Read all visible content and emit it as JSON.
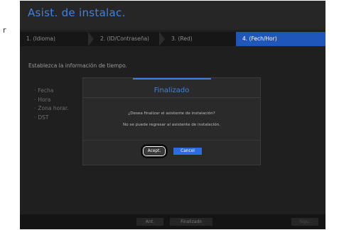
{
  "stray": "r",
  "window": {
    "title": "Asist. de instalac."
  },
  "steps": [
    {
      "label": "1. (Idioma)"
    },
    {
      "label": "2. (ID/Contraseña)"
    },
    {
      "label": "3. (Red)"
    },
    {
      "label": "4. (Fech/Hor)",
      "active": true
    }
  ],
  "main": {
    "instruction": "Establezca la información de tiempo.",
    "fields": [
      "Fecha",
      "Hora",
      "Zona horar.",
      "DST"
    ]
  },
  "dialog": {
    "title": "Finalizado",
    "message_1": "¿Desea finalizar el asistente de instalación?",
    "message_2": "No se puede regresar al asistente de instalación.",
    "accept_label": "Acept.",
    "cancel_label": "Cancel"
  },
  "footer": {
    "prev_label": "Ant.",
    "finish_label": "Finalizado",
    "next_label": "Sigu."
  },
  "colors": {
    "accent": "#3f82e0",
    "active_step": "#1f56b9",
    "cancel_button": "#2f6be0",
    "background": "#1f1f1f"
  }
}
